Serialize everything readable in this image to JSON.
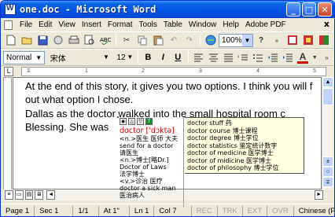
{
  "window": {
    "title": "one.doc - Microsoft Word",
    "min": "_",
    "max": "□",
    "close": "✕"
  },
  "menu": [
    "File",
    "Edit",
    "View",
    "Insert",
    "Format",
    "Tools",
    "Table",
    "Window",
    "Help",
    "Adobe PDF"
  ],
  "menu_close": "x",
  "toolbar": {
    "zoom": "100%"
  },
  "format": {
    "style": "Normal",
    "font": "宋体",
    "size": "12",
    "bold": "B",
    "italic": "I",
    "underline": "U"
  },
  "ruler_marks": [
    "1",
    "2",
    "3",
    "4",
    "5"
  ],
  "document": {
    "lines": [
      "At the end of this story, it gives you two options. I think you will f",
      "out what option I chose.",
      "Dallas  as  the  doctor  walked  into  the  small  hospital  room  c",
      "Blessing. She was"
    ]
  },
  "popup": {
    "word": "doctor ['dɔktə]",
    "defs": [
      "<n.>医生 医师 大夫",
      "send for a doctor",
      "请医生",
      "<n.>博士[略Dr.]",
      "Doctor of Laws",
      "法学博士",
      "<v.>诊治 医疗",
      "doctor a sick man",
      "医治病人"
    ],
    "phrases": [
      "doctor stuff 药",
      "doctor course 博士课程",
      "doctor degree 博士学位",
      "doctor statistics 鉴定统计数字",
      "doctor of medicine 医学博士",
      "doctor of midicine 医学博士",
      "doctor of philosophy 博士学位"
    ]
  },
  "status": {
    "page": "Page 1",
    "sec": "Sec 1",
    "pages": "1/1",
    "at": "At 1\"",
    "ln": "Ln 1",
    "col": "Col 7",
    "rec": "REC",
    "trk": "TRK",
    "ext": "EXT",
    "ovr": "OVR",
    "lang": "Chinese (P"
  }
}
